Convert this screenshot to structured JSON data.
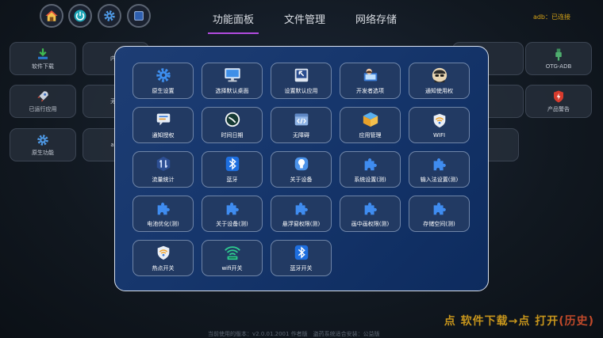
{
  "top": {
    "tabs": [
      "功能面板",
      "文件管理",
      "网络存储"
    ],
    "status": "adb：已连接",
    "icons": [
      "home-icon",
      "power-icon",
      "gear-icon",
      "stop-icon"
    ]
  },
  "background": {
    "tiles": [
      "软件下载",
      "内核",
      "OTG-ADB",
      "已运行应用",
      "无障",
      "产品警告",
      "原生功能",
      "adb"
    ]
  },
  "panel": {
    "items": [
      {
        "label": "原生设置",
        "icon": "gear-icon"
      },
      {
        "label": "选择默认桌面",
        "icon": "monitor-icon"
      },
      {
        "label": "设置默认应用",
        "icon": "app-window-icon"
      },
      {
        "label": "开发者选项",
        "icon": "developer-icon"
      },
      {
        "label": "通知使用权",
        "icon": "spy-icon"
      },
      {
        "label": "通知授权",
        "icon": "chat-icon"
      },
      {
        "label": "时间日期",
        "icon": "clock-icon"
      },
      {
        "label": "无障碍",
        "icon": "code-icon"
      },
      {
        "label": "应用管理",
        "icon": "box-icon"
      },
      {
        "label": "WIFI",
        "icon": "wifi-icon"
      },
      {
        "label": "流量统计",
        "icon": "traffic-icon"
      },
      {
        "label": "蓝牙",
        "icon": "bluetooth-icon"
      },
      {
        "label": "关于设备",
        "icon": "about-icon"
      },
      {
        "label": "系统设置(测)",
        "icon": "puzzle-icon"
      },
      {
        "label": "输入法设置(测)",
        "icon": "puzzle-icon"
      },
      {
        "label": "电池优化(测)",
        "icon": "puzzle-icon"
      },
      {
        "label": "关于设备(测)",
        "icon": "puzzle-icon"
      },
      {
        "label": "悬浮窗权限(测)",
        "icon": "puzzle-icon"
      },
      {
        "label": "画中画权限(测)",
        "icon": "puzzle-icon"
      },
      {
        "label": "存储空间(测)",
        "icon": "puzzle-icon"
      },
      {
        "label": "热点开关",
        "icon": "hotspot-icon"
      },
      {
        "label": "wifi开关",
        "icon": "wifi-switch-icon"
      },
      {
        "label": "蓝牙开关",
        "icon": "bluetooth-icon"
      }
    ]
  },
  "footer": {
    "text": "当前使用的版本：v2.0.01.2001 作者版　盗药系统适合安装：公益版"
  },
  "hint": {
    "main": "点 软件下载→点 打开",
    "history": "(历史)"
  },
  "colors": {
    "accent": "#b24be0",
    "panel": "#16366c",
    "status": "#d6a317",
    "hint": "#c8961c"
  }
}
